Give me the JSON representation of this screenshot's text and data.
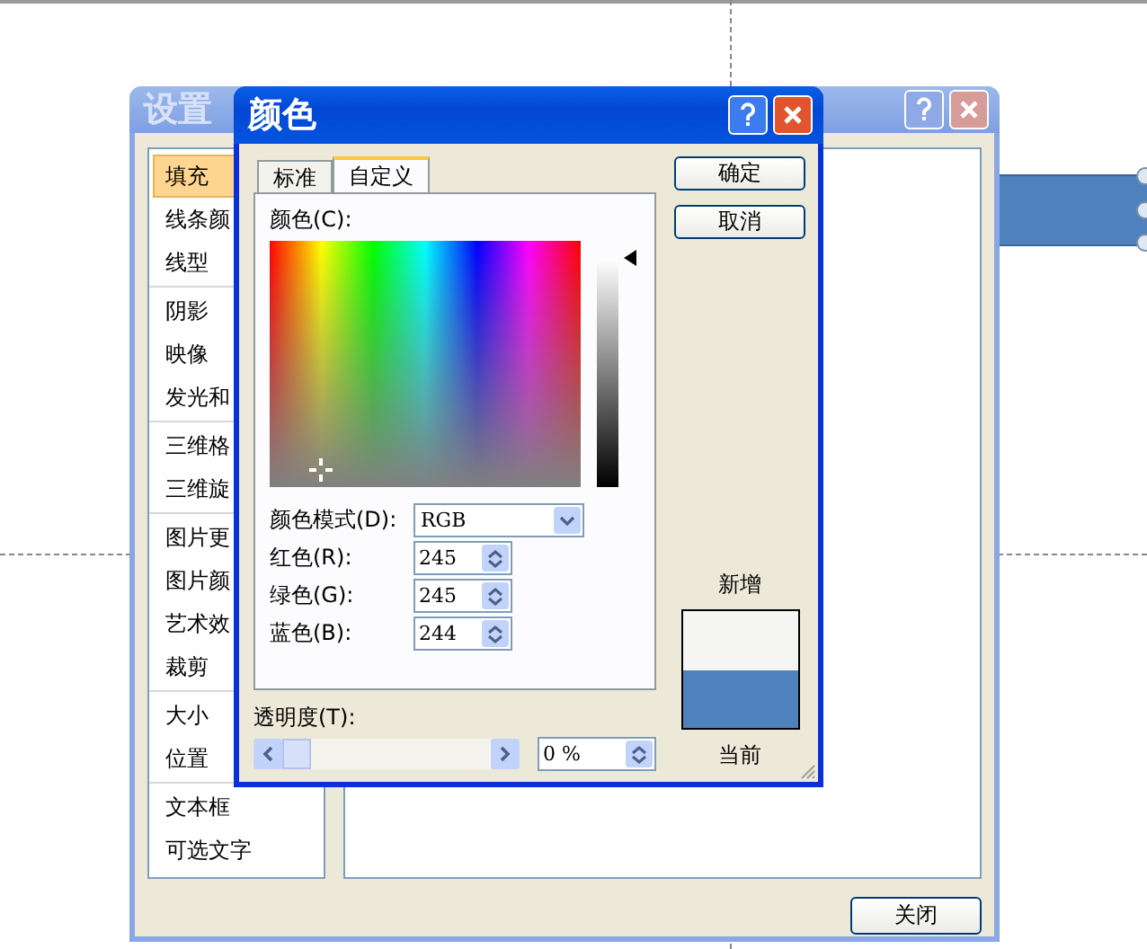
{
  "back_dialog": {
    "title": "设置",
    "categories": [
      [
        {
          "label": "填充",
          "selected": true
        },
        {
          "label": "线条颜",
          "selected": false
        },
        {
          "label": "线型",
          "selected": false
        }
      ],
      [
        {
          "label": "阴影",
          "selected": false
        },
        {
          "label": "映像",
          "selected": false
        },
        {
          "label": "发光和",
          "selected": false
        }
      ],
      [
        {
          "label": "三维格",
          "selected": false
        },
        {
          "label": "三维旋",
          "selected": false
        }
      ],
      [
        {
          "label": "图片更",
          "selected": false
        },
        {
          "label": "图片颜",
          "selected": false
        },
        {
          "label": "艺术效",
          "selected": false
        },
        {
          "label": "裁剪",
          "selected": false
        }
      ],
      [
        {
          "label": "大小",
          "selected": false
        },
        {
          "label": "位置",
          "selected": false
        }
      ],
      [
        {
          "label": "文本框",
          "selected": false
        },
        {
          "label": "可选文字",
          "selected": false
        }
      ]
    ],
    "close_button": "关闭"
  },
  "color_dialog": {
    "title": "颜色",
    "tabs": [
      {
        "label": "标准",
        "selected": false
      },
      {
        "label": "自定义",
        "selected": true
      }
    ],
    "colors_label": "颜色(C):",
    "color_model": {
      "label": "颜色模式(D):",
      "value": "RGB"
    },
    "channels": [
      {
        "label": "红色(R):",
        "value": "245"
      },
      {
        "label": "绿色(G):",
        "value": "245"
      },
      {
        "label": "蓝色(B):",
        "value": "244"
      }
    ],
    "transparency": {
      "label": "透明度(T):",
      "level": 0,
      "value": "0 %"
    },
    "buttons": [
      "确定",
      "取消"
    ],
    "new_label": "新增",
    "new_swatch": {
      "color": "#f5f5f4"
    },
    "current_swatch": {
      "color": "#4f81bd"
    },
    "current_label": "当前"
  }
}
